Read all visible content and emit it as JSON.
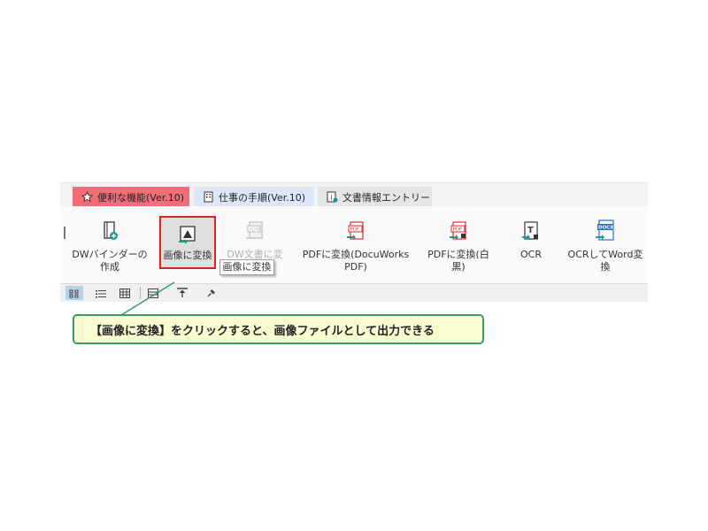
{
  "tabs": [
    {
      "label": "便利な機能(Ver.10)",
      "icon": "star-icon",
      "color": "#f36d78"
    },
    {
      "label": "仕事の手順(Ver.10)",
      "icon": "building-icon",
      "color": "#dde7f8"
    },
    {
      "label": "文書情報エントリー",
      "icon": "info-doc-icon",
      "color": "#e6e6e6"
    }
  ],
  "ribbon": {
    "commands": [
      {
        "label": "DWバインダーの作成",
        "icon": "binder-add-icon",
        "enabled": true
      },
      {
        "label": "画像に変換",
        "icon": "image-convert-icon",
        "enabled": true,
        "highlighted": true
      },
      {
        "label": "DW文書に変",
        "icon": "dw-doc-icon",
        "enabled": false
      },
      {
        "label": "PDFに変換(DocuWorks PDF)",
        "icon": "pdf-convert-icon",
        "enabled": true
      },
      {
        "label": "PDFに変換(白黒)",
        "icon": "pdf-bw-icon",
        "enabled": true
      },
      {
        "label": "OCR",
        "icon": "ocr-icon",
        "enabled": true
      },
      {
        "label": "OCRしてWord変換",
        "icon": "docx-icon",
        "enabled": true
      }
    ],
    "tooltip": "画像に変換"
  },
  "toolbar": {
    "buttons": [
      {
        "name": "large-icons-view-icon",
        "active": true
      },
      {
        "name": "list-view-icon",
        "active": false
      },
      {
        "name": "grid-view-icon",
        "active": false
      },
      {
        "name": "panel-view-icon",
        "active": false
      },
      {
        "name": "export-up-icon",
        "active": false
      },
      {
        "name": "pin-icon",
        "active": false
      }
    ]
  },
  "callout": {
    "text": "【画像に変換】をクリックすると、画像ファイルとして出力できる",
    "border_color": "#3a9a6a",
    "background": "#fbfbd2"
  },
  "accent": {
    "highlight_border": "#e21e1e"
  }
}
